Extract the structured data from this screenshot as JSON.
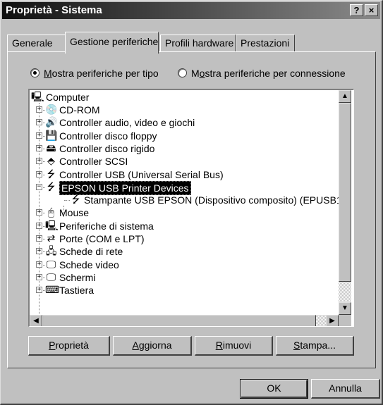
{
  "window": {
    "title": "Proprietà - Sistema",
    "help_btn": "?",
    "close_btn": "×"
  },
  "tabs": [
    {
      "label": "Generale",
      "active": false
    },
    {
      "label": "Gestione periferiche",
      "active": true
    },
    {
      "label": "Profili hardware",
      "active": false
    },
    {
      "label": "Prestazioni",
      "active": false
    }
  ],
  "view_options": {
    "by_type": {
      "label": "Mostra periferiche per tipo",
      "mnemonic": "M",
      "rest": "ostra periferiche per tipo",
      "selected": true
    },
    "by_connection": {
      "label": "Mostra periferiche per connessione",
      "pre": "M",
      "mnemonic": "o",
      "rest": "stra periferiche per connessione",
      "selected": false
    }
  },
  "tree": {
    "root": "Computer",
    "items": [
      {
        "label": "CD-ROM",
        "icon": "cdrom-icon",
        "expanded": false
      },
      {
        "label": "Controller audio, video e giochi",
        "icon": "multimedia-icon",
        "expanded": false
      },
      {
        "label": "Controller disco floppy",
        "icon": "floppy-icon",
        "expanded": false
      },
      {
        "label": "Controller disco rigido",
        "icon": "harddisk-icon",
        "expanded": false
      },
      {
        "label": "Controller SCSI",
        "icon": "scsi-icon",
        "expanded": false
      },
      {
        "label": "Controller USB (Universal Serial Bus)",
        "icon": "usb-icon",
        "expanded": false
      },
      {
        "label": "EPSON USB Printer Devices",
        "icon": "usb-icon",
        "expanded": true,
        "selected": true
      },
      {
        "label": "Stampante USB EPSON (Dispositivo composito) (EPUSB1:",
        "icon": "usb-icon",
        "child": true
      },
      {
        "label": "Mouse",
        "icon": "mouse-icon",
        "expanded": false
      },
      {
        "label": "Periferiche di sistema",
        "icon": "system-icon",
        "expanded": false
      },
      {
        "label": "Porte (COM e LPT)",
        "icon": "port-icon",
        "expanded": false
      },
      {
        "label": "Schede di rete",
        "icon": "network-icon",
        "expanded": false
      },
      {
        "label": "Schede video",
        "icon": "monitor-icon",
        "expanded": false
      },
      {
        "label": "Schermi",
        "icon": "monitor-icon",
        "expanded": false
      },
      {
        "label": "Tastiera",
        "icon": "keyboard-icon",
        "expanded": false
      }
    ]
  },
  "actions": {
    "properties": {
      "mnemonic": "P",
      "rest": "roprietà"
    },
    "refresh": {
      "mnemonic": "A",
      "rest": "ggiorna"
    },
    "remove": {
      "mnemonic": "R",
      "rest": "imuovi"
    },
    "print": {
      "mnemonic": "S",
      "rest": "tampa..."
    }
  },
  "footer": {
    "ok": "OK",
    "cancel": "Annulla"
  }
}
